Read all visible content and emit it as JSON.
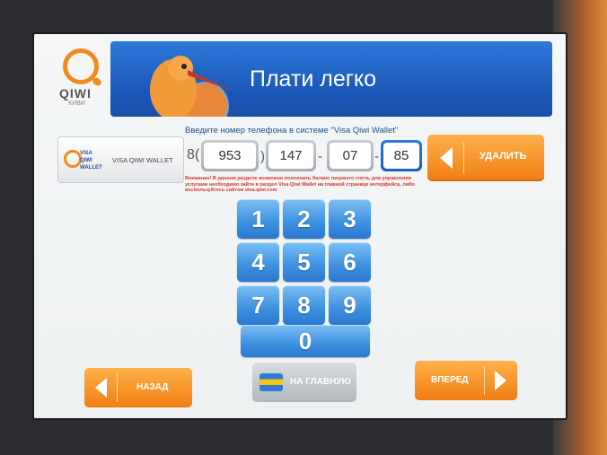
{
  "header": {
    "brand": "QIWI",
    "brand_sub": "КИВИ",
    "title": "Плати легко"
  },
  "prompt": "Введите номер телефона в системе \"Visa Qiwi Wallet\"",
  "wallet": {
    "badge": "VISA\nQIWI\nWALLET",
    "label": "VISA QIWI WALLET"
  },
  "phone": {
    "prefix": "8(",
    "code": "953",
    "close_paren": ")",
    "part1": "147",
    "dash1": "-",
    "part2": "07",
    "dash2": "-",
    "part3": "85"
  },
  "delete_label": "УДАЛИТЬ",
  "warning": "Внимание! В данном разделе возможно пополнить баланс лицевого счета, для управления услугами необходимо зайти в раздел Visa Qiwi Wallet на главной странице интерфейса, либо воспользуйтесь сайтом visa.qiwi.com",
  "keypad": [
    "1",
    "2",
    "3",
    "4",
    "5",
    "6",
    "7",
    "8",
    "9",
    "0"
  ],
  "nav": {
    "back_label": "НАЗАД",
    "home_label": "НА ГЛАВНУЮ",
    "forward_label": "ВПЕРЕД"
  },
  "colors": {
    "accent_orange": "#f07d12",
    "accent_blue": "#2a78cf"
  }
}
